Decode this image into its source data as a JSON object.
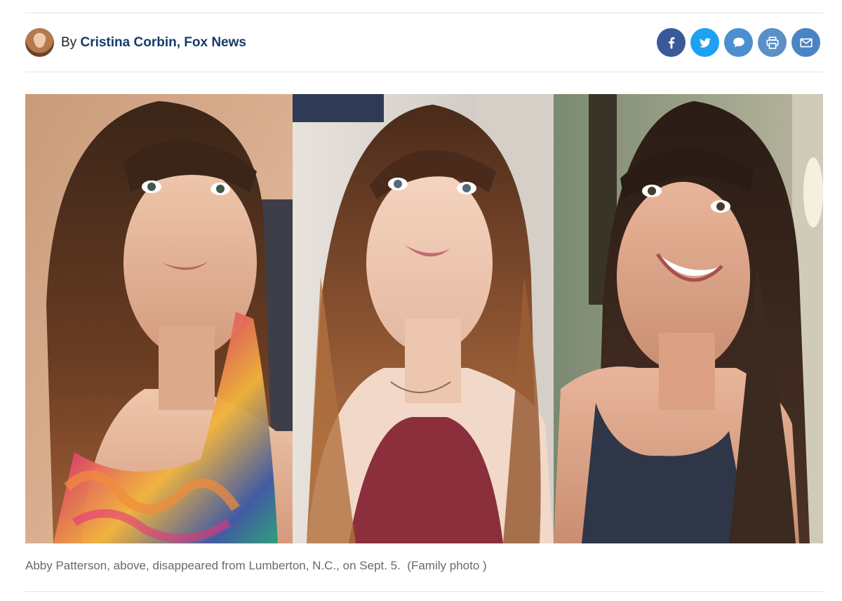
{
  "byline": {
    "prefix": "By",
    "author": "Cristina Corbin, Fox News",
    "avatar_icon": "author-avatar"
  },
  "share": {
    "buttons": [
      {
        "name": "facebook",
        "icon": "facebook-icon",
        "color": "#3b5998"
      },
      {
        "name": "twitter",
        "icon": "twitter-icon",
        "color": "#1da1f2"
      },
      {
        "name": "comments",
        "icon": "comment-icon",
        "color": "#4b8fd0"
      },
      {
        "name": "print",
        "icon": "print-icon",
        "color": "#5b8fc7"
      },
      {
        "name": "email",
        "icon": "email-icon",
        "color": "#4a84c4"
      }
    ]
  },
  "image": {
    "description_panels": 3
  },
  "caption": {
    "text": "Abby Patterson, above, disappeared from Lumberton, N.C., on Sept. 5.  (Family photo )"
  },
  "colors": {
    "author_link": "#183b6a",
    "caption_text": "#666a70"
  }
}
